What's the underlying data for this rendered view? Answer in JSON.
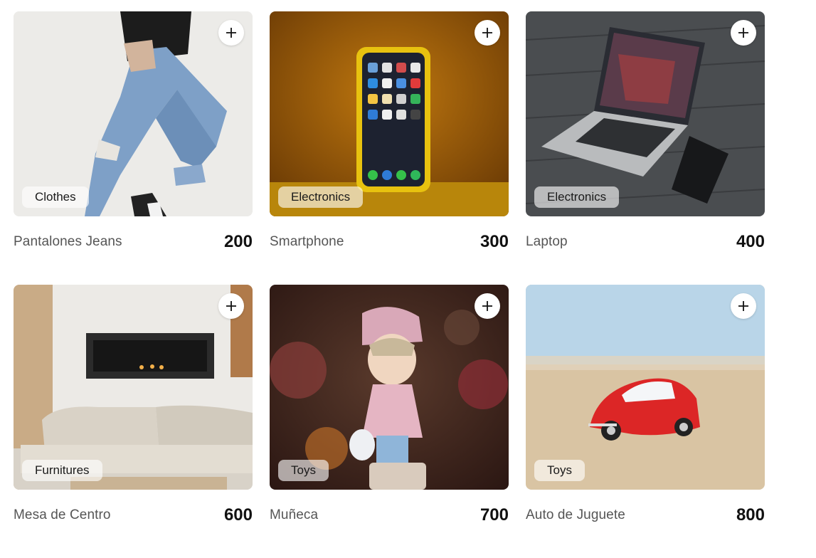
{
  "products": [
    {
      "name": "Pantalones Jeans",
      "price": "200",
      "category": "Clothes",
      "image": "jeans-photo"
    },
    {
      "name": "Smartphone",
      "price": "300",
      "category": "Electronics",
      "image": "smartphone-photo"
    },
    {
      "name": "Laptop",
      "price": "400",
      "category": "Electronics",
      "image": "laptop-photo"
    },
    {
      "name": "Mesa de Centro",
      "price": "600",
      "category": "Furnitures",
      "image": "living-room-photo"
    },
    {
      "name": "Muñeca",
      "price": "700",
      "category": "Toys",
      "image": "doll-photo"
    },
    {
      "name": "Auto de Juguete",
      "price": "800",
      "category": "Toys",
      "image": "toy-car-photo"
    }
  ],
  "add_icon": "plus-icon"
}
